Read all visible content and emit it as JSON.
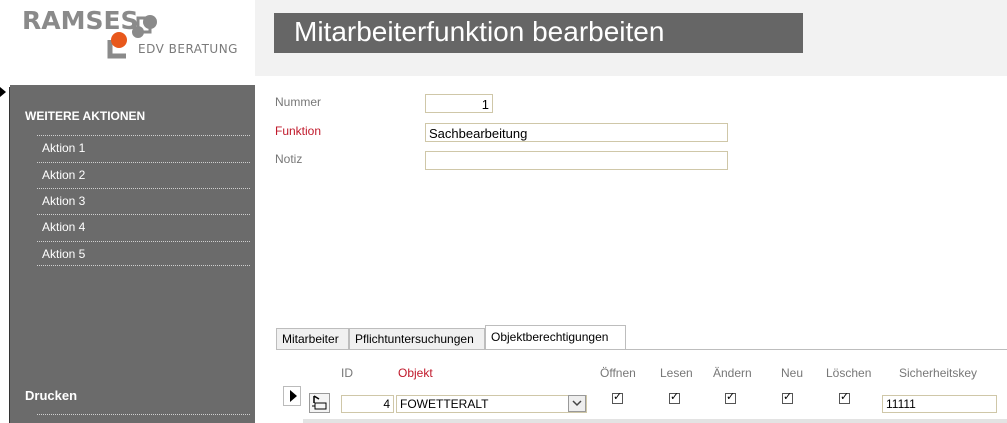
{
  "logo": {
    "brand": "RAMSES",
    "subtitle": "EDV BERATUNG"
  },
  "header": {
    "title": "Mitarbeiterfunktion bearbeiten"
  },
  "sidebar": {
    "section_title": "WEITERE AKTIONEN",
    "items": [
      {
        "label": "Aktion 1"
      },
      {
        "label": "Aktion 2"
      },
      {
        "label": "Aktion 3"
      },
      {
        "label": "Aktion 4"
      },
      {
        "label": "Aktion 5"
      }
    ],
    "print_title": "Drucken"
  },
  "form": {
    "nummer_label": "Nummer",
    "nummer_value": "1",
    "funktion_label": "Funktion",
    "funktion_value": "Sachbearbeitung",
    "notiz_label": "Notiz",
    "notiz_value": ""
  },
  "tabs": [
    {
      "label": "Mitarbeiter",
      "active": false
    },
    {
      "label": "Pflichtuntersuchungen",
      "active": false
    },
    {
      "label": "Objektberechtigungen",
      "active": true
    }
  ],
  "grid": {
    "columns": {
      "id": "ID",
      "objekt": "Objekt",
      "oeffnen": "Öffnen",
      "lesen": "Lesen",
      "aendern": "Ändern",
      "neu": "Neu",
      "loeschen": "Löschen",
      "sicherheitskey": "Sicherheitskey"
    },
    "rows": [
      {
        "id": "4",
        "objekt": "FOWETTERALT",
        "oeffnen": true,
        "lesen": true,
        "aendern": true,
        "neu": true,
        "loeschen": true,
        "sicherheitskey": "11111"
      }
    ]
  },
  "colors": {
    "sidebar_bg": "#6b6b6b",
    "title_bar_bg": "#666666",
    "required_label": "#c0182a",
    "logo_orange": "#e8581c"
  }
}
